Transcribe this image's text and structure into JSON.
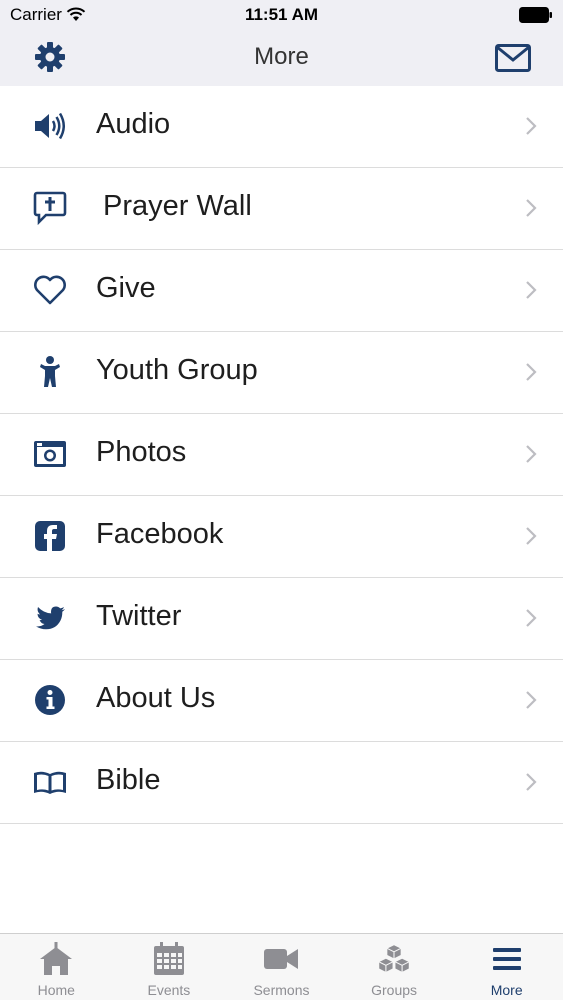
{
  "status": {
    "carrier": "Carrier",
    "time": "11:51 AM"
  },
  "nav": {
    "title": "More"
  },
  "colors": {
    "accent": "#1f3f6d",
    "chevron": "#bdbdc2",
    "inactive": "#8e8e93"
  },
  "menu": [
    {
      "label": "Audio",
      "icon": "speaker-icon"
    },
    {
      "label": "Prayer Wall",
      "icon": "prayer-wall-icon"
    },
    {
      "label": "Give",
      "icon": "heart-icon"
    },
    {
      "label": "Youth Group",
      "icon": "person-icon"
    },
    {
      "label": "Photos",
      "icon": "camera-icon"
    },
    {
      "label": "Facebook",
      "icon": "facebook-icon"
    },
    {
      "label": "Twitter",
      "icon": "twitter-icon"
    },
    {
      "label": "About Us",
      "icon": "info-icon"
    },
    {
      "label": "Bible",
      "icon": "book-icon"
    }
  ],
  "tabs": [
    {
      "label": "Home",
      "icon": "home-icon"
    },
    {
      "label": "Events",
      "icon": "calendar-icon"
    },
    {
      "label": "Sermons",
      "icon": "video-icon"
    },
    {
      "label": "Groups",
      "icon": "cubes-icon"
    },
    {
      "label": "More",
      "icon": "menu-icon",
      "active": true
    }
  ]
}
